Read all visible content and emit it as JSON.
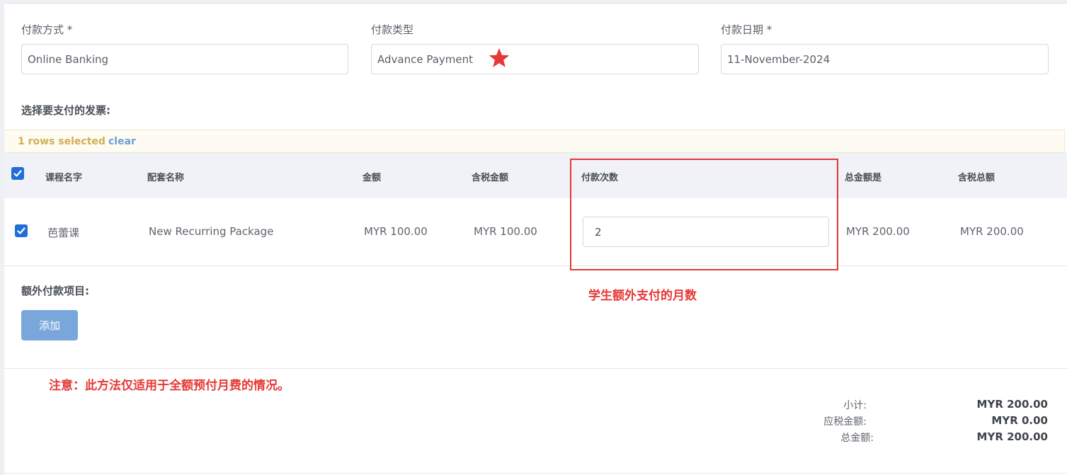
{
  "form": {
    "payment_method": {
      "label": "付款方式 *",
      "value": "Online Banking"
    },
    "payment_type": {
      "label": "付款类型",
      "value": "Advance Payment"
    },
    "payment_date": {
      "label": "付款日期 *",
      "value": "11-November-2024"
    }
  },
  "invoices": {
    "title": "选择要支付的发票:",
    "selection_text": "1 rows selected",
    "clear_label": "clear",
    "columns": [
      "课程名字",
      "配套名称",
      "金额",
      "含税金额",
      "付款次数",
      "总金额是",
      "含税总额"
    ],
    "rows": [
      {
        "checked": true,
        "course_name": "芭蕾课",
        "package_name": "New Recurring Package",
        "amount": "MYR 100.00",
        "amount_with_tax": "MYR 100.00",
        "payment_count": "2",
        "total_amount": "MYR 200.00",
        "total_with_tax": "MYR 200.00"
      }
    ]
  },
  "extra": {
    "title": "额外付款项目:",
    "add_label": "添加"
  },
  "annotations": {
    "months_note": "学生额外支付的月数",
    "warning": "注意：此方法仅适用于全额预付月费的情况。",
    "color": "#e53935"
  },
  "summary": {
    "subtotal_label": "小计:",
    "subtotal_value": "MYR 200.00",
    "tax_label": "应税金额:",
    "tax_value": "MYR 0.00",
    "total_label": "总金额:",
    "total_value": "MYR 200.00"
  },
  "colors": {
    "accent": "#1f6fd6",
    "add_button": "#7aa7db",
    "selection_text": "#d4ae58",
    "clear_link": "#6fa0d6"
  }
}
